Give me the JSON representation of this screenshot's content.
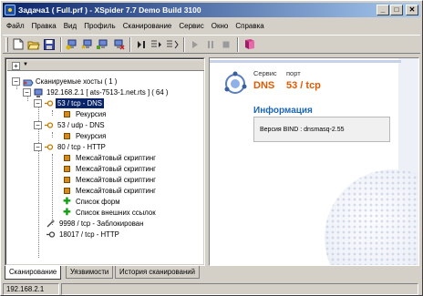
{
  "window": {
    "title": "Задача1 ( Full.prf ) - XSpider 7.7 Demo Build 3100",
    "minimize": "_",
    "maximize": "□",
    "close": "✕"
  },
  "menu": [
    "Файл",
    "Правка",
    "Вид",
    "Профиль",
    "Сканирование",
    "Сервис",
    "Окно",
    "Справка"
  ],
  "tree": {
    "root": "Сканируемые хосты ( 1 )",
    "host": "192.168.2.1 [ ats-7513-1.net.rts ] ( 64 )",
    "items": [
      "53 / tcp - DNS",
      "Рекурсия",
      "53 / udp - DNS",
      "Рекурсия",
      "80 / tcp - HTTP",
      "Межсайтовый скриптинг",
      "Межсайтовый скриптинг",
      "Межсайтовый скриптинг",
      "Межсайтовый скриптинг",
      "Список форм",
      "Список внешних ссылок",
      "9998 / tcp - Заблокирован",
      "18017 / tcp - HTTP"
    ]
  },
  "detail": {
    "service_label": "Сервис",
    "port_label": "порт",
    "service_value": "DNS",
    "port_value": "53 / tcp",
    "info_heading": "Информация",
    "info_text": "Версия BIND : dnsmasq-2.55"
  },
  "tabs": [
    "Сканирование",
    "Уязвимости",
    "История сканирований"
  ],
  "status": {
    "host": "192.168.2.1"
  },
  "colors": {
    "selection": "#0a246a",
    "accent": "#e05a00",
    "heading": "#1a66b4"
  }
}
